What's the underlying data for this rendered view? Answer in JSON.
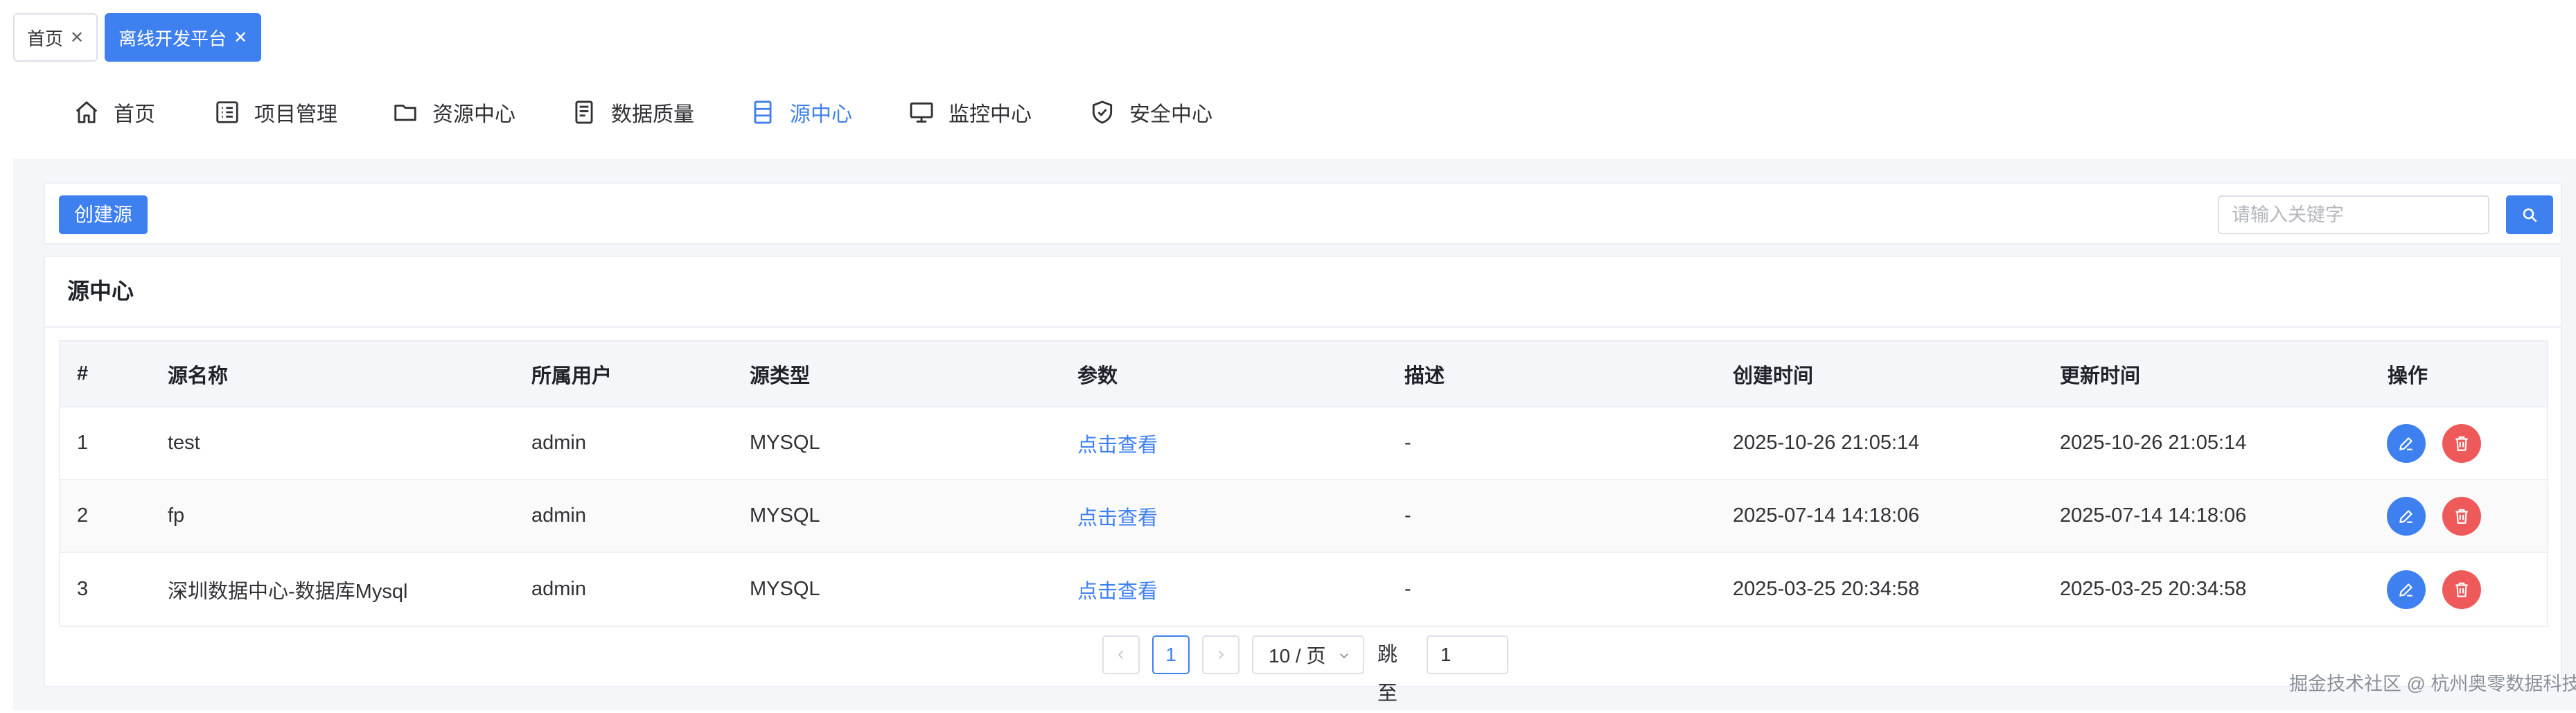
{
  "tabs": [
    {
      "label": "首页",
      "active": false
    },
    {
      "label": "离线开发平台",
      "active": true
    }
  ],
  "nav": [
    {
      "label": "首页",
      "icon": "home-icon",
      "active": false
    },
    {
      "label": "项目管理",
      "icon": "list-icon",
      "active": false
    },
    {
      "label": "资源中心",
      "icon": "folder-icon",
      "active": false
    },
    {
      "label": "数据质量",
      "icon": "document-icon",
      "active": false
    },
    {
      "label": "源中心",
      "icon": "server-icon",
      "active": true
    },
    {
      "label": "监控中心",
      "icon": "monitor-icon",
      "active": false
    },
    {
      "label": "安全中心",
      "icon": "shield-check-icon",
      "active": false
    }
  ],
  "toolbar": {
    "create_label": "创建源",
    "search_placeholder": "请输入关键字",
    "search_value": ""
  },
  "card": {
    "title": "源中心"
  },
  "table": {
    "headers": [
      "#",
      "源名称",
      "所属用户",
      "源类型",
      "参数",
      "描述",
      "创建时间",
      "更新时间",
      "操作"
    ],
    "rows": [
      {
        "index": "1",
        "name": "test",
        "user": "admin",
        "type": "MYSQL",
        "params": "点击查看",
        "desc": "-",
        "created": "2025-10-26 21:05:14",
        "updated": "2025-10-26 21:05:14"
      },
      {
        "index": "2",
        "name": "fp",
        "user": "admin",
        "type": "MYSQL",
        "params": "点击查看",
        "desc": "-",
        "created": "2025-07-14 14:18:06",
        "updated": "2025-07-14 14:18:06"
      },
      {
        "index": "3",
        "name": "深圳数据中心-数据库Mysql",
        "user": "admin",
        "type": "MYSQL",
        "params": "点击查看",
        "desc": "-",
        "created": "2025-03-25 20:34:58",
        "updated": "2025-03-25 20:34:58"
      }
    ]
  },
  "pagination": {
    "current_page": "1",
    "page_size_label": "10 / 页",
    "jump_label": "跳至",
    "jump_value": "1"
  },
  "watermark": "掘金技术社区 @ 杭州奥零数据科技",
  "colors": {
    "accent": "#3f80f0",
    "danger": "#ee5a5a",
    "background": "#f5f6fa"
  }
}
